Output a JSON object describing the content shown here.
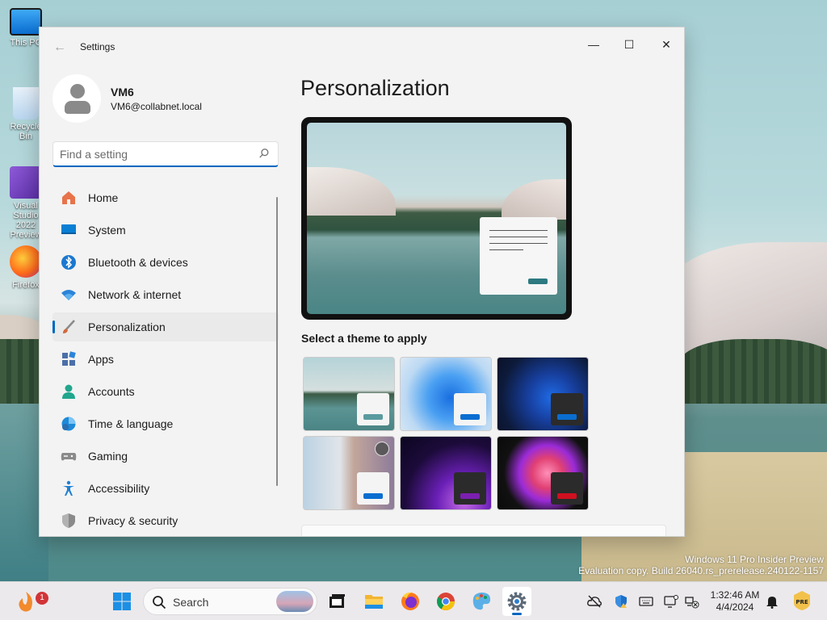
{
  "desktop": {
    "icons": [
      {
        "label": "This PC",
        "icon": "monitor-icon"
      },
      {
        "label": "Recycle Bin",
        "icon": "recycle-bin-icon"
      },
      {
        "label": "Visual Studio 2022 Preview",
        "icon": "visual-studio-icon"
      },
      {
        "label": "Firefox",
        "icon": "firefox-icon"
      }
    ],
    "watermark_line1": "Windows 11 Pro Insider Preview",
    "watermark_line2": "Evaluation copy. Build 26040.rs_prerelease.240122-1157"
  },
  "window": {
    "title": "Settings",
    "back_icon": "back-arrow-icon",
    "controls": {
      "minimize": "—",
      "maximize": "☐",
      "close": "✕"
    }
  },
  "profile": {
    "name": "VM6",
    "email": "VM6@collabnet.local"
  },
  "search": {
    "placeholder": "Find a setting",
    "value": ""
  },
  "nav": {
    "items": [
      {
        "label": "Home",
        "icon": "home-icon",
        "color": "#e8734a"
      },
      {
        "label": "System",
        "icon": "monitor-icon",
        "color": "#0a7fd4"
      },
      {
        "label": "Bluetooth & devices",
        "icon": "bluetooth-icon",
        "color": "#1a78d0"
      },
      {
        "label": "Network & internet",
        "icon": "wifi-icon",
        "color": "#2b84d8"
      },
      {
        "label": "Personalization",
        "icon": "brush-icon",
        "color": "#d0683c",
        "active": true
      },
      {
        "label": "Apps",
        "icon": "apps-icon",
        "color": "#4c6fa8"
      },
      {
        "label": "Accounts",
        "icon": "person-icon",
        "color": "#21a68d"
      },
      {
        "label": "Time & language",
        "icon": "globe-clock-icon",
        "color": "#1d8ad8"
      },
      {
        "label": "Gaming",
        "icon": "gamepad-icon",
        "color": "#7a7a7a"
      },
      {
        "label": "Accessibility",
        "icon": "accessibility-icon",
        "color": "#1f7fd1"
      },
      {
        "label": "Privacy & security",
        "icon": "shield-icon",
        "color": "#8a8a8a"
      }
    ]
  },
  "content": {
    "title": "Personalization",
    "theme_label": "Select a theme to apply",
    "themes": [
      {
        "name": "theme-lake",
        "accent": "#5a9ba0",
        "window": "#f4f4f4"
      },
      {
        "name": "theme-bloom-light",
        "accent": "#0a6ed1",
        "window": "#f4f4f4"
      },
      {
        "name": "theme-bloom-dark",
        "accent": "#0a6ed1",
        "window": "#2b2b2b"
      },
      {
        "name": "theme-spotlight",
        "accent": "#0a6ed1",
        "window": "#f4f4f4"
      },
      {
        "name": "theme-glow",
        "accent": "#7a1fb0",
        "window": "#2b2b2b"
      },
      {
        "name": "theme-captured-motion",
        "accent": "#d01020",
        "window": "#2b2b2b"
      }
    ]
  },
  "taskbar": {
    "search_label": "Search",
    "notification_count": "1",
    "time": "1:32:46 AM",
    "date": "4/4/2024",
    "accent": "#0067c0",
    "apps": [
      {
        "name": "start-button",
        "icon": "windows-logo-icon"
      },
      {
        "name": "task-view-button",
        "icon": "task-view-icon"
      },
      {
        "name": "file-explorer-button",
        "icon": "folder-icon"
      },
      {
        "name": "firefox-button",
        "icon": "firefox-icon"
      },
      {
        "name": "chrome-button",
        "icon": "chrome-icon"
      },
      {
        "name": "paint-button",
        "icon": "paint-icon"
      },
      {
        "name": "settings-button",
        "icon": "gear-icon",
        "active": true
      }
    ]
  }
}
